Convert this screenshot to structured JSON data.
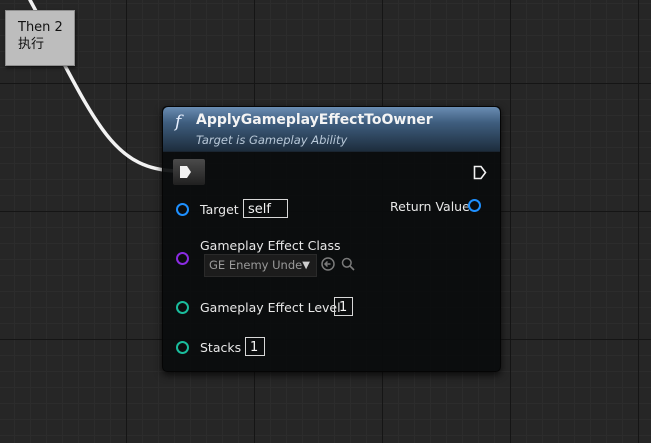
{
  "reroute_node": {
    "line1": "Then 2",
    "line2": "执行"
  },
  "node": {
    "function_icon": "f",
    "title": "ApplyGameplayEffectToOwner",
    "subtitle": "Target is Gameplay Ability",
    "return_label": "Return Value",
    "pins": {
      "target": {
        "label": "Target",
        "value": "self",
        "color": "#1e90ff"
      },
      "effect_class": {
        "label": "Gameplay Effect Class",
        "value": "GE Enemy Unde",
        "color": "#8a2be2"
      },
      "effect_level": {
        "label": "Gameplay Effect Level",
        "value": "1",
        "color": "#1abc9c"
      },
      "stacks": {
        "label": "Stacks",
        "value": "1",
        "color": "#1abc9c"
      }
    },
    "icons": [
      "play-icon",
      "exec-out-icon",
      "chevron-down-icon",
      "browse-arrow-icon",
      "search-icon"
    ]
  }
}
